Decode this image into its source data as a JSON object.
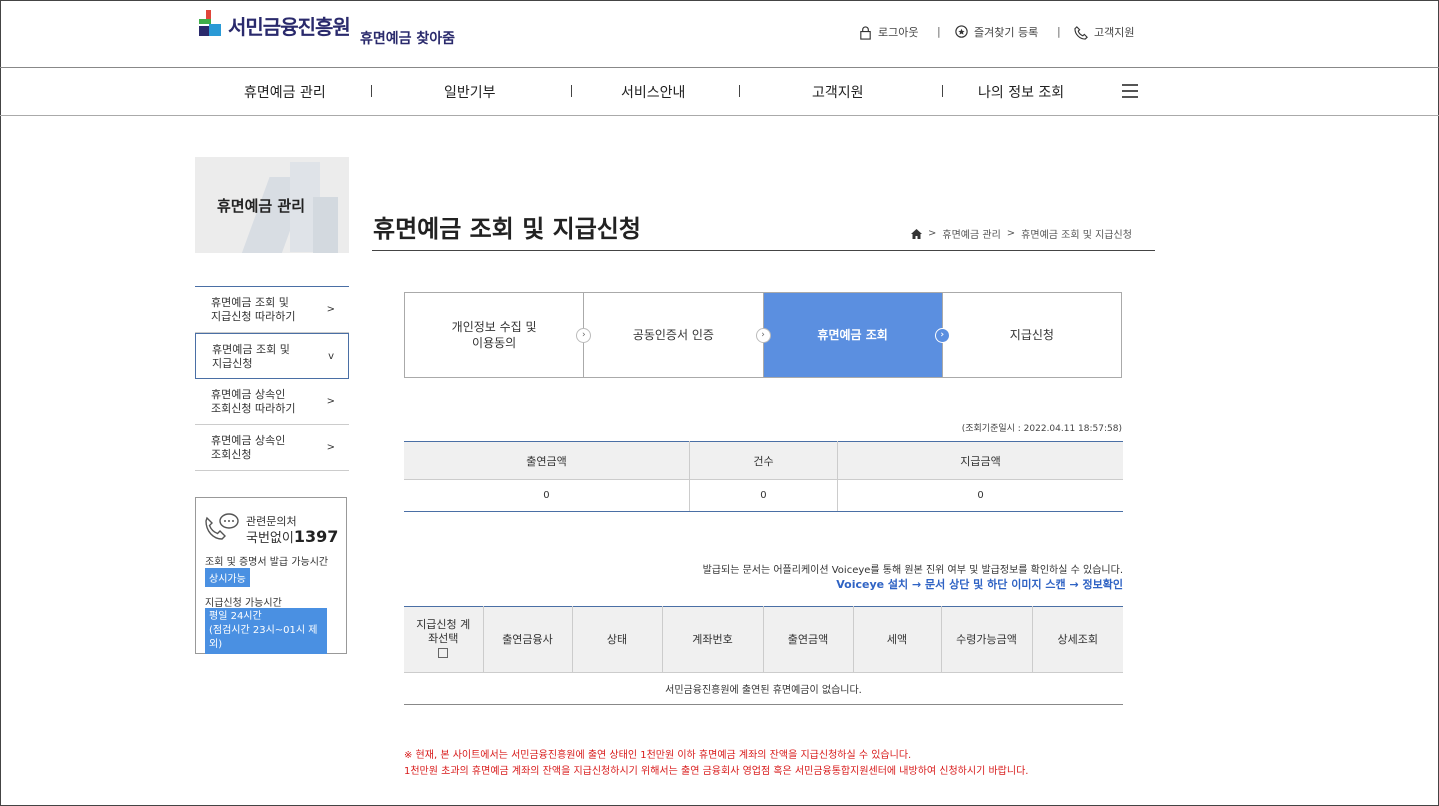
{
  "header": {
    "logo_text": "서민금융진흥원",
    "logo_sub": "휴면예금 찾아줌",
    "util": {
      "logout": "로그아웃",
      "favorite": "즐겨찾기 등록",
      "support": "고객지원"
    }
  },
  "gnb": {
    "items": [
      "휴면예금 관리",
      "일반기부",
      "서비스안내",
      "고객지원",
      "나의 정보 조회"
    ]
  },
  "lnb": {
    "title": "휴면예금 관리",
    "items": [
      {
        "line1": "휴면예금 조회 및",
        "line2": "지급신청 따라하기",
        "arrow": ">"
      },
      {
        "line1": "휴면예금 조회 및",
        "line2": "지급신청",
        "arrow": "v"
      },
      {
        "line1": "휴면예금 상속인",
        "line2": "조회신청 따라하기",
        "arrow": ">"
      },
      {
        "line1": "휴면예금 상속인",
        "line2": "조회신청",
        "arrow": ">"
      }
    ]
  },
  "cs": {
    "label": "관련문의처",
    "phone_prefix": "국번없이",
    "phone": "1397",
    "time1_label": "조회 및 증명서 발급 가능시간",
    "time1_value": "상시가능",
    "time2_label": "지급신청 가능시간",
    "time2_value_l1": "평일 24시간",
    "time2_value_l2": "(점검시간 23시~01시 제외)"
  },
  "page": {
    "title": "휴면예금 조회 및 지급신청",
    "breadcrumb": [
      "휴면예금 관리",
      "휴면예금 조회 및 지급신청"
    ]
  },
  "steps": [
    {
      "line1": "개인정보 수집 및",
      "line2": "이용동의"
    },
    {
      "line1": "공동인증서 인증",
      "line2": ""
    },
    {
      "line1": "휴면예금 조회",
      "line2": ""
    },
    {
      "line1": "지급신청",
      "line2": ""
    }
  ],
  "timestamp": "(조회기준일시 : 2022.04.11 18:57:58)",
  "summary": {
    "headers": [
      "출연금액",
      "건수",
      "지급금액"
    ],
    "values": [
      "0",
      "0",
      "0"
    ]
  },
  "notice": {
    "line1": "발급되는 문서는 어플리케이션 Voiceye를 통해 원본 진위 여부 및 발급정보를 확인하실 수 있습니다.",
    "line2": "Voiceye 설치 → 문서 상단 및 하단 이미지 스캔 → 정보확인"
  },
  "accounts": {
    "headers": [
      "지급신청 계좌선택",
      "출연금융사",
      "상태",
      "계좌번호",
      "출연금액",
      "세액",
      "수령가능금액",
      "상세조회"
    ],
    "empty_message": "서민금융진흥원에 출연된 휴면예금이 없습니다."
  },
  "warning": {
    "line1": "※ 현재, 본 사이트에서는 서민금융진흥원에 출연 상태인 1천만원 이하 휴면예금 계좌의 잔액을 지급신청하실 수 있습니다.",
    "line2": "1천만원 초과의 휴면예금 계좌의 잔액을 지급신청하시기 위해서는 출연 금융회사 영업점 혹은 서민금융통합지원센터에 내방하여 신청하시기 바랍니다."
  }
}
